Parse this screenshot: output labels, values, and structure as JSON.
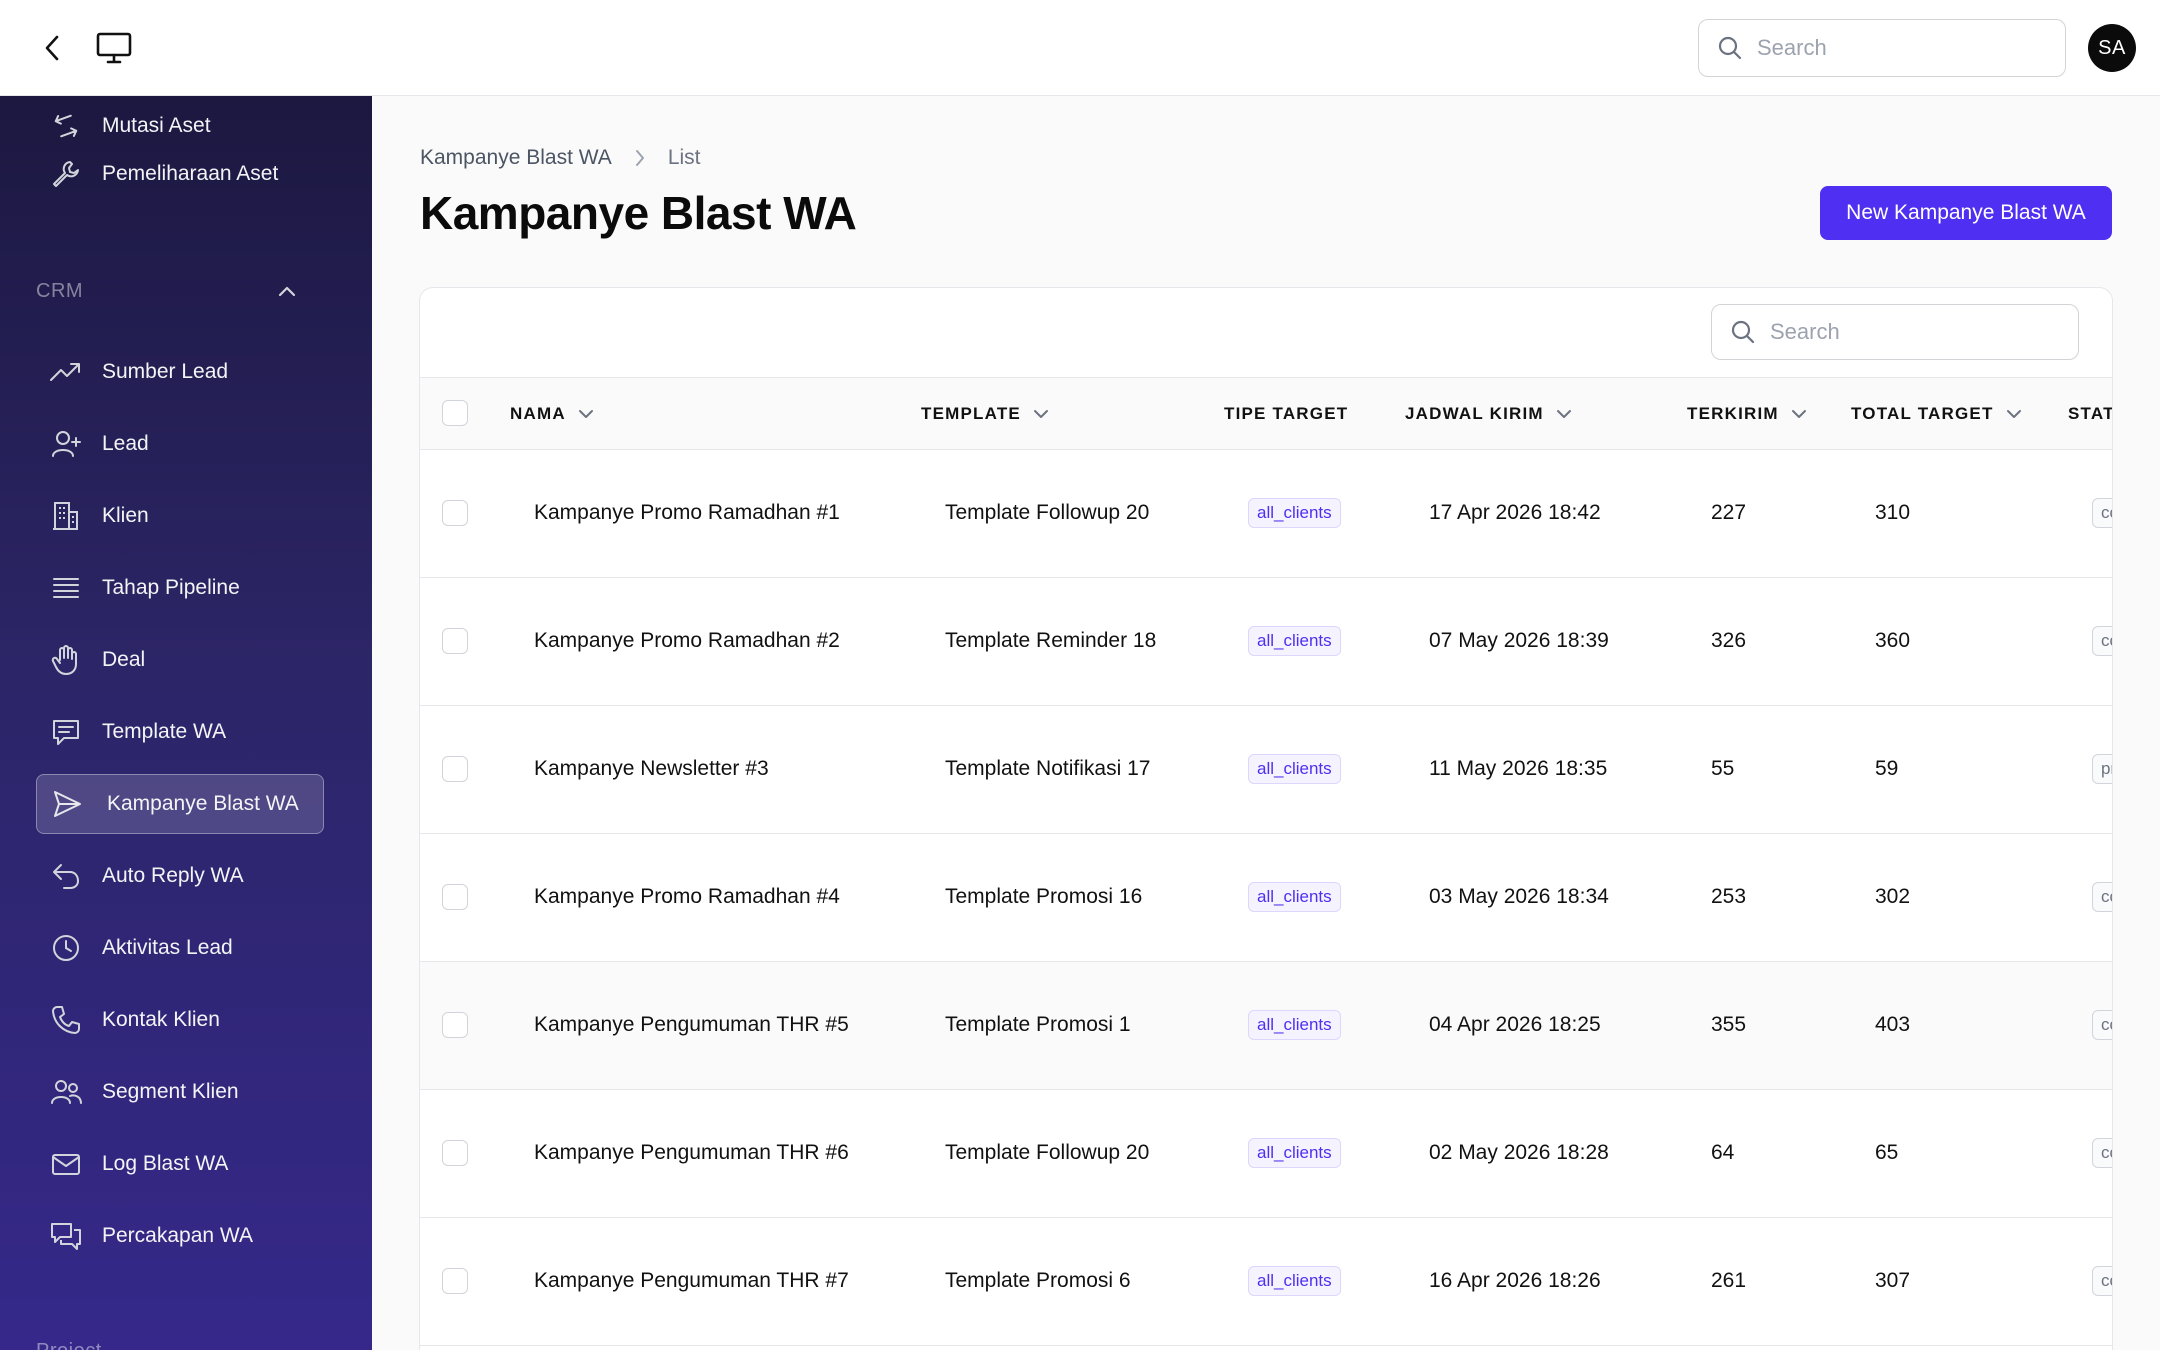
{
  "topbar": {
    "search_placeholder": "Search",
    "avatar_initials": "SA"
  },
  "sidebar": {
    "items_top": [
      {
        "label": "Mutasi Aset",
        "icon": "arrows-exchange-icon"
      },
      {
        "label": "Pemeliharaan Aset",
        "icon": "wrench-icon"
      }
    ],
    "crm_section": "CRM",
    "crm_items": [
      {
        "label": "Sumber Lead",
        "icon": "trending-up-icon"
      },
      {
        "label": "Lead",
        "icon": "user-plus-icon"
      },
      {
        "label": "Klien",
        "icon": "building-icon"
      },
      {
        "label": "Tahap Pipeline",
        "icon": "list-lines-icon"
      },
      {
        "label": "Deal",
        "icon": "hand-icon"
      },
      {
        "label": "Template WA",
        "icon": "chat-text-icon"
      },
      {
        "label": "Kampanye Blast WA",
        "icon": "send-icon",
        "active": true
      },
      {
        "label": "Auto Reply WA",
        "icon": "reply-arrow-icon"
      },
      {
        "label": "Aktivitas Lead",
        "icon": "clock-icon"
      },
      {
        "label": "Kontak Klien",
        "icon": "phone-icon"
      },
      {
        "label": "Segment Klien",
        "icon": "users-icon"
      },
      {
        "label": "Log Blast WA",
        "icon": "envelope-icon"
      },
      {
        "label": "Percakapan WA",
        "icon": "chat-bubbles-icon"
      }
    ],
    "next_section": "Project"
  },
  "breadcrumb": {
    "parent": "Kampanye Blast WA",
    "current": "List"
  },
  "page": {
    "title": "Kampanye Blast WA",
    "new_button": "New Kampanye Blast WA"
  },
  "table": {
    "search_placeholder": "Search",
    "headers": {
      "nama": "NAMA",
      "template": "TEMPLATE",
      "tipe_target": "TIPE TARGET",
      "jadwal_kirim": "JADWAL KIRIM",
      "terkirim": "TERKIRIM",
      "total_target": "TOTAL TARGET",
      "status": "STAT"
    },
    "rows": [
      {
        "nama": "Kampanye Promo Ramadhan #1",
        "template": "Template Followup 20",
        "tipe_target": "all_clients",
        "jadwal_kirim": "17 Apr 2026 18:42",
        "terkirim": "227",
        "total_target": "310",
        "status": "co"
      },
      {
        "nama": "Kampanye Promo Ramadhan #2",
        "template": "Template Reminder 18",
        "tipe_target": "all_clients",
        "jadwal_kirim": "07 May 2026 18:39",
        "terkirim": "326",
        "total_target": "360",
        "status": "co"
      },
      {
        "nama": "Kampanye Newsletter #3",
        "template": "Template Notifikasi 17",
        "tipe_target": "all_clients",
        "jadwal_kirim": "11 May 2026 18:35",
        "terkirim": "55",
        "total_target": "59",
        "status": "pr"
      },
      {
        "nama": "Kampanye Promo Ramadhan #4",
        "template": "Template Promosi 16",
        "tipe_target": "all_clients",
        "jadwal_kirim": "03 May 2026 18:34",
        "terkirim": "253",
        "total_target": "302",
        "status": "co"
      },
      {
        "nama": "Kampanye Pengumuman THR #5",
        "template": "Template Promosi 1",
        "tipe_target": "all_clients",
        "jadwal_kirim": "04 Apr 2026 18:25",
        "terkirim": "355",
        "total_target": "403",
        "status": "co"
      },
      {
        "nama": "Kampanye Pengumuman THR #6",
        "template": "Template Followup 20",
        "tipe_target": "all_clients",
        "jadwal_kirim": "02 May 2026 18:28",
        "terkirim": "64",
        "total_target": "65",
        "status": "co"
      },
      {
        "nama": "Kampanye Pengumuman THR #7",
        "template": "Template Promosi 6",
        "tipe_target": "all_clients",
        "jadwal_kirim": "16 Apr 2026 18:26",
        "terkirim": "261",
        "total_target": "307",
        "status": "co"
      }
    ]
  },
  "colors": {
    "accent": "#4f2ff2",
    "sidebar_top": "#1c1840",
    "sidebar_bottom": "#35288a"
  }
}
